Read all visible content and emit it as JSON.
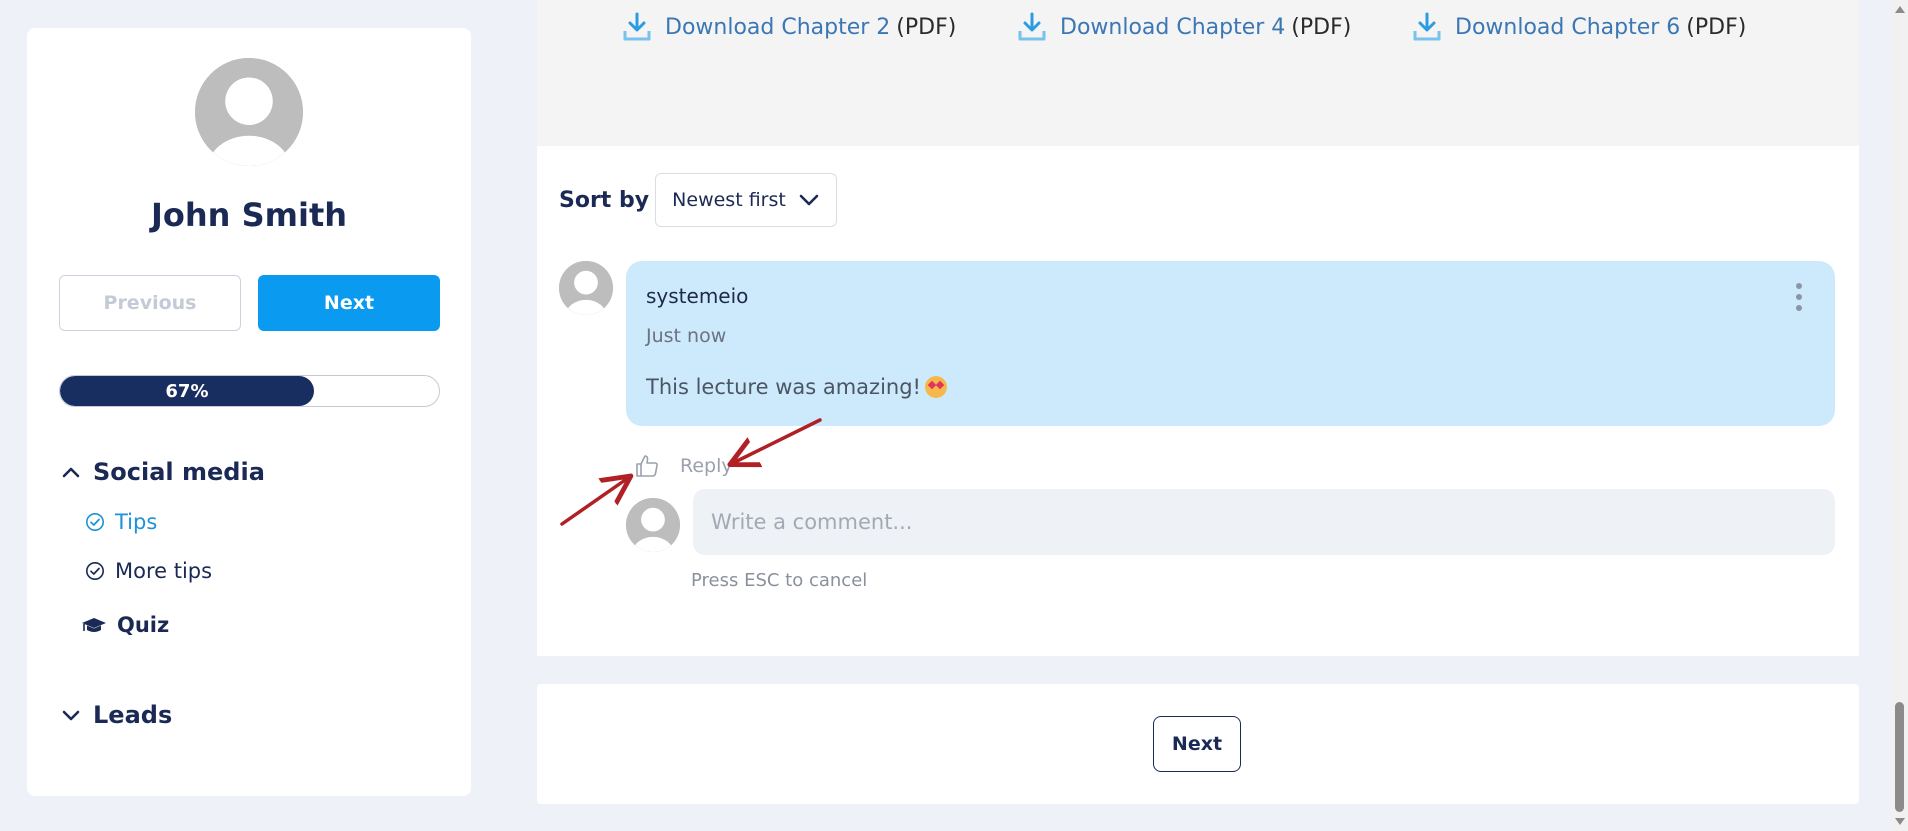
{
  "sidebar": {
    "profile_name": "John Smith",
    "previous_label": "Previous",
    "next_label": "Next",
    "progress": {
      "percent": 67,
      "label": "67%"
    },
    "sections": [
      {
        "title": "Social media",
        "expanded": true,
        "icon": "chevron-up-icon",
        "lessons": [
          {
            "label": "Tips",
            "active": true,
            "icon": "check-circle-icon"
          },
          {
            "label": "More tips",
            "active": false,
            "icon": "check-circle-icon"
          },
          {
            "label": "Quiz",
            "active": false,
            "icon": "graduation-cap-icon"
          }
        ]
      },
      {
        "title": "Leads",
        "expanded": false,
        "icon": "chevron-down-icon"
      }
    ]
  },
  "downloads": [
    {
      "link": "Download Chapter 2",
      "suffix": "(PDF)",
      "icon": "download-icon"
    },
    {
      "link": "Download Chapter 4",
      "suffix": "(PDF)",
      "icon": "download-icon"
    },
    {
      "link": "Download Chapter 6",
      "suffix": "(PDF)",
      "icon": "download-icon"
    }
  ],
  "comments": {
    "sort_label": "Sort by",
    "sort_value": "Newest first",
    "items": [
      {
        "author": "systemeio",
        "time": "Just now",
        "text": "This lecture was amazing!",
        "emoji": "heart-eyes-emoji"
      }
    ],
    "reply_label": "Reply",
    "input_placeholder": "Write a comment...",
    "esc_hint": "Press ESC to cancel"
  },
  "footer": {
    "next_label": "Next"
  },
  "colors": {
    "primary": "#0a9af0",
    "navy": "#1b2a55",
    "comment_bubble": "#cdeafc",
    "annotation_arrow": "#b02024"
  }
}
